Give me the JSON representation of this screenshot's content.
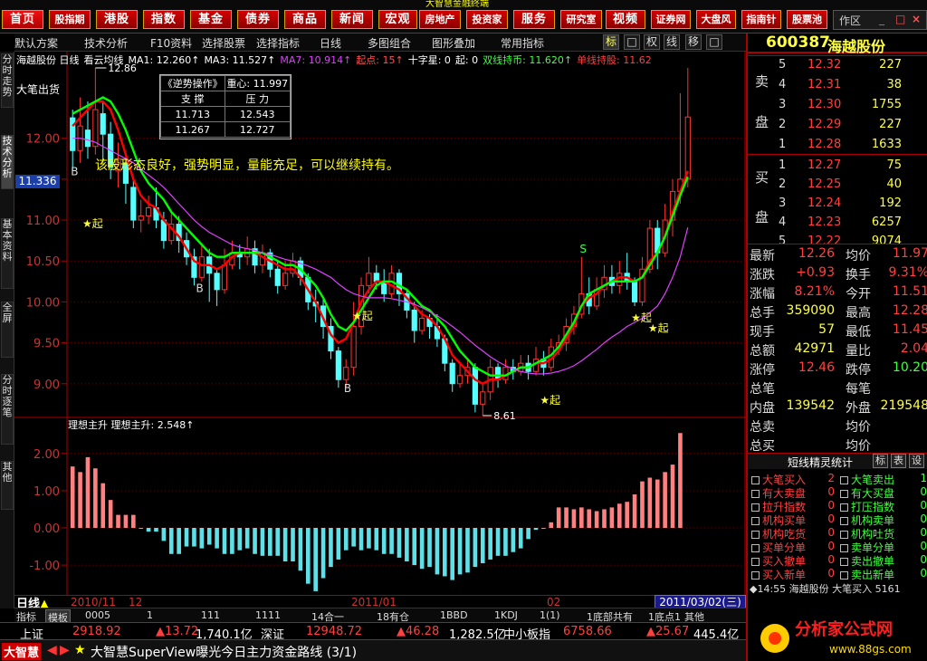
{
  "nav": {
    "items": [
      "首页",
      "股指期",
      "港股",
      "指数",
      "基金",
      "债券",
      "商品",
      "新闻",
      "宏观",
      "房地产",
      "投资家",
      "服务",
      "研究室",
      "视频",
      "证券网",
      "大盘风",
      "指南针",
      "股票池"
    ],
    "banner": "大智慧金融终端",
    "win_label": "作区",
    "win_min": "_",
    "win_restore": "□",
    "win_close": "×"
  },
  "toolbar": {
    "items": [
      "默认方案",
      "技术分析",
      "F10资料",
      "选择股票",
      "选择指标",
      "日线",
      "多图组合",
      "图形叠加",
      "常用指标"
    ],
    "buttons": [
      "标",
      "□",
      "权",
      "线",
      "移",
      "□"
    ]
  },
  "left_tabs": [
    "分时走势",
    "技术分析",
    "基本资料",
    "全屏",
    "分时逐笔",
    "其他"
  ],
  "chart": {
    "indicator_header": [
      "海越股份 日线",
      "看云均线",
      "MA1: 12.260↑",
      "MA3: 11.527↑",
      "MA7: 10.914↑",
      "起点: 15↑",
      "十字星: 0",
      "起: 0",
      "双线持币: 11.620↑",
      "单线持股: 11.62"
    ],
    "top_label": "12.86",
    "low_label": "8.61",
    "bigpen_label": "大笔出货",
    "current_price_label": "11.336",
    "comment": "该股形态良好，强势明显，量能充足，可以继续持有。",
    "sr_box": {
      "title": "《逆势操作》",
      "center": "重心: 11.997",
      "col1": "支 撑",
      "col2": "压 力",
      "rows": [
        [
          "11.713",
          "12.543"
        ],
        [
          "11.267",
          "12.727"
        ]
      ]
    },
    "markers": {
      "qi": "★起",
      "b": "B",
      "s": "S"
    },
    "osc_header": "理想主升  理想主升: 2.548↑",
    "day_line_label": "日线",
    "dates": [
      "2010/11",
      "12",
      "2011/01",
      "02"
    ],
    "date_box": "2011/03/02(三)"
  },
  "chart_data": [
    {
      "type": "candlestick",
      "title": "海越股份 日线",
      "ylim": [
        8.61,
        12.86
      ],
      "y_ticks": [
        9.0,
        9.5,
        10.0,
        10.5,
        11.0,
        11.5,
        12.0
      ],
      "candles": [
        [
          12.25,
          11.85,
          12.35,
          11.6
        ],
        [
          11.85,
          12.15,
          12.5,
          11.7
        ],
        [
          12.1,
          11.9,
          12.45,
          11.75
        ],
        [
          11.9,
          12.35,
          12.86,
          11.8
        ],
        [
          12.3,
          12.05,
          12.45,
          11.7
        ],
        [
          12.05,
          11.65,
          12.2,
          11.5
        ],
        [
          11.6,
          11.75,
          11.95,
          11.4
        ],
        [
          11.7,
          11.45,
          11.8,
          11.2
        ],
        [
          11.4,
          11.0,
          11.5,
          10.9
        ],
        [
          11.0,
          11.05,
          11.25,
          10.85
        ],
        [
          11.05,
          11.15,
          11.3,
          10.95
        ],
        [
          11.15,
          11.0,
          11.4,
          10.9
        ],
        [
          11.0,
          10.75,
          11.1,
          10.65
        ],
        [
          10.75,
          10.95,
          11.1,
          10.7
        ],
        [
          10.95,
          10.75,
          11.05,
          10.6
        ],
        [
          10.75,
          10.55,
          10.85,
          10.45
        ],
        [
          10.55,
          10.3,
          10.65,
          10.2
        ],
        [
          10.3,
          10.55,
          10.7,
          10.25
        ],
        [
          10.55,
          10.35,
          10.65,
          10.0
        ],
        [
          10.35,
          10.15,
          10.4,
          9.95
        ],
        [
          10.15,
          10.45,
          10.65,
          10.1
        ],
        [
          10.45,
          10.6,
          10.75,
          10.4
        ],
        [
          10.6,
          10.55,
          10.7,
          10.4
        ],
        [
          10.55,
          10.65,
          10.8,
          10.45
        ],
        [
          10.65,
          10.45,
          10.75,
          10.35
        ],
        [
          10.45,
          10.6,
          10.7,
          10.35
        ],
        [
          10.6,
          10.4,
          10.65,
          10.3
        ],
        [
          10.4,
          10.2,
          10.5,
          10.1
        ],
        [
          10.2,
          10.35,
          10.5,
          10.15
        ],
        [
          10.35,
          10.5,
          10.6,
          10.3
        ],
        [
          10.5,
          10.3,
          10.55,
          10.2
        ],
        [
          10.3,
          10.0,
          10.35,
          9.9
        ],
        [
          10.0,
          9.95,
          10.15,
          9.75
        ],
        [
          9.95,
          9.7,
          10.05,
          9.55
        ],
        [
          9.7,
          9.4,
          9.8,
          9.3
        ],
        [
          9.4,
          9.05,
          9.45,
          8.95
        ],
        [
          9.05,
          9.2,
          9.3,
          8.95
        ],
        [
          9.2,
          9.7,
          10.0,
          9.1
        ],
        [
          9.7,
          10.2,
          10.3,
          9.6
        ],
        [
          10.2,
          10.35,
          10.55,
          10.1
        ],
        [
          10.35,
          10.25,
          10.45,
          10.15
        ],
        [
          10.25,
          10.1,
          10.4,
          10.0
        ],
        [
          10.1,
          10.35,
          10.45,
          10.05
        ],
        [
          10.35,
          10.1,
          10.4,
          9.95
        ],
        [
          10.1,
          9.9,
          10.15,
          9.8
        ],
        [
          9.9,
          9.65,
          10.0,
          9.5
        ],
        [
          9.65,
          9.8,
          9.9,
          9.6
        ],
        [
          9.8,
          9.7,
          9.85,
          9.55
        ],
        [
          9.7,
          9.55,
          9.85,
          9.45
        ],
        [
          9.55,
          9.25,
          9.6,
          9.15
        ],
        [
          9.25,
          9.0,
          9.3,
          8.9
        ],
        [
          9.0,
          9.1,
          9.25,
          8.95
        ],
        [
          9.1,
          9.2,
          9.3,
          9.0
        ],
        [
          9.2,
          8.75,
          9.25,
          8.65
        ],
        [
          8.75,
          8.9,
          9.0,
          8.61
        ],
        [
          8.9,
          9.2,
          9.3,
          8.8
        ],
        [
          9.2,
          9.05,
          9.25,
          8.95
        ],
        [
          9.05,
          9.2,
          9.3,
          9.0
        ],
        [
          9.2,
          9.15,
          9.3,
          9.05
        ],
        [
          9.15,
          9.25,
          9.35,
          9.1
        ],
        [
          9.25,
          9.15,
          9.35,
          9.05
        ],
        [
          9.15,
          9.3,
          9.45,
          9.1
        ],
        [
          9.3,
          9.2,
          9.4,
          9.1
        ],
        [
          9.2,
          9.45,
          9.55,
          9.15
        ],
        [
          9.45,
          9.5,
          9.6,
          9.35
        ],
        [
          9.5,
          9.7,
          9.8,
          9.4
        ],
        [
          9.7,
          9.85,
          9.95,
          9.6
        ],
        [
          9.85,
          10.1,
          10.55,
          9.8
        ],
        [
          10.1,
          9.95,
          10.3,
          9.85
        ],
        [
          9.95,
          10.15,
          10.3,
          9.9
        ],
        [
          10.15,
          10.3,
          10.45,
          10.05
        ],
        [
          10.3,
          10.2,
          10.45,
          10.1
        ],
        [
          10.2,
          10.35,
          10.5,
          10.1
        ],
        [
          10.35,
          10.25,
          10.6,
          10.15
        ],
        [
          10.25,
          10.0,
          10.3,
          9.95
        ],
        [
          10.0,
          10.4,
          10.55,
          9.95
        ],
        [
          10.4,
          10.9,
          11.0,
          10.35
        ],
        [
          10.9,
          10.6,
          11.0,
          10.4
        ],
        [
          10.6,
          11.0,
          11.2,
          10.55
        ],
        [
          11.0,
          11.35,
          11.5,
          10.8
        ],
        [
          11.35,
          11.5,
          12.55,
          11.2
        ],
        [
          11.5,
          12.26,
          12.86,
          11.4
        ]
      ],
      "ma_series": [
        {
          "name": "MA1",
          "color": "#ff0000",
          "values": [
            12.15,
            12.25,
            12.35,
            12.45,
            12.45,
            12.35,
            12.1,
            11.8,
            11.5,
            11.3,
            11.2,
            11.15,
            11.0,
            10.9,
            10.8,
            10.65,
            10.5,
            10.45,
            10.45,
            10.4,
            10.45,
            10.55,
            10.6,
            10.6,
            10.6,
            10.55,
            10.5,
            10.45,
            10.4,
            10.4,
            10.3,
            10.15,
            10.0,
            9.8,
            9.6,
            9.5,
            9.55,
            9.75,
            10.0,
            10.15,
            10.25,
            10.25,
            10.2,
            10.15,
            10.05,
            9.95,
            9.85,
            9.8,
            9.7,
            9.55,
            9.35,
            9.25,
            9.15,
            9.05,
            9.0,
            9.05,
            9.05,
            9.1,
            9.15,
            9.2,
            9.2,
            9.25,
            9.25,
            9.3,
            9.4,
            9.55,
            9.7,
            9.95,
            10.05,
            10.1,
            10.2,
            10.25,
            10.3,
            10.3,
            10.25,
            10.3,
            10.5,
            10.6,
            10.8,
            11.1,
            11.35,
            11.6
          ]
        },
        {
          "name": "MA3",
          "color": "#00ff00",
          "values": [
            12.3,
            12.35,
            12.4,
            12.45,
            12.5,
            12.45,
            12.3,
            12.1,
            11.85,
            11.6,
            11.45,
            11.35,
            11.25,
            11.1,
            11.0,
            10.9,
            10.8,
            10.7,
            10.6,
            10.55,
            10.55,
            10.6,
            10.6,
            10.6,
            10.6,
            10.6,
            10.55,
            10.5,
            10.45,
            10.45,
            10.4,
            10.3,
            10.2,
            10.05,
            9.85,
            9.7,
            9.65,
            9.75,
            9.9,
            10.05,
            10.2,
            10.25,
            10.25,
            10.2,
            10.15,
            10.05,
            9.95,
            9.9,
            9.8,
            9.7,
            9.55,
            9.4,
            9.3,
            9.2,
            9.15,
            9.1,
            9.1,
            9.1,
            9.15,
            9.2,
            9.2,
            9.25,
            9.3,
            9.35,
            9.45,
            9.6,
            9.75,
            9.95,
            10.1,
            10.15,
            10.2,
            10.25,
            10.25,
            10.25,
            10.25,
            10.3,
            10.45,
            10.6,
            10.8,
            11.05,
            11.3,
            11.53
          ]
        },
        {
          "name": "MA7",
          "color": "#e040ff",
          "values": [
            12.0,
            12.0,
            11.98,
            11.95,
            11.9,
            11.85,
            11.8,
            11.75,
            11.7,
            11.62,
            11.55,
            11.48,
            11.4,
            11.3,
            11.2,
            11.1,
            11.0,
            10.92,
            10.85,
            10.8,
            10.75,
            10.7,
            10.67,
            10.65,
            10.63,
            10.6,
            10.58,
            10.55,
            10.52,
            10.5,
            10.47,
            10.44,
            10.4,
            10.35,
            10.3,
            10.22,
            10.15,
            10.1,
            10.07,
            10.05,
            10.05,
            10.05,
            10.04,
            10.02,
            10.0,
            9.97,
            9.93,
            9.88,
            9.83,
            9.77,
            9.7,
            9.63,
            9.55,
            9.47,
            9.4,
            9.33,
            9.27,
            9.22,
            9.18,
            9.15,
            9.13,
            9.12,
            9.12,
            9.13,
            9.15,
            9.18,
            9.22,
            9.28,
            9.35,
            9.42,
            9.5,
            9.57,
            9.63,
            9.7,
            9.75,
            9.8,
            9.87,
            9.95,
            10.1,
            10.3,
            10.55,
            10.91
          ]
        }
      ]
    },
    {
      "type": "bar",
      "title": "理想主升",
      "ylim": [
        -1.8,
        2.7
      ],
      "y_ticks": [
        -1.0,
        0.0,
        1.0,
        2.0
      ],
      "values": [
        1.65,
        1.5,
        1.9,
        1.6,
        1.2,
        0.75,
        0.35,
        0.35,
        0.35,
        0.0,
        -0.1,
        -0.1,
        -0.35,
        -0.7,
        -0.7,
        -0.5,
        -0.5,
        -0.55,
        -0.45,
        -0.55,
        -0.7,
        -0.7,
        -0.6,
        -0.55,
        -0.7,
        -0.75,
        -0.75,
        -0.75,
        -0.9,
        -0.9,
        -1.15,
        -1.5,
        -1.7,
        -1.35,
        -1.05,
        -0.85,
        -0.6,
        -0.5,
        -0.6,
        -0.55,
        -0.6,
        -0.7,
        -0.7,
        -0.8,
        -0.9,
        -1.0,
        -1.1,
        -1.05,
        -1.25,
        -1.3,
        -1.4,
        -1.25,
        -1.2,
        -1.05,
        -0.95,
        -0.85,
        -0.75,
        -0.75,
        -0.65,
        -0.55,
        -0.3,
        -0.05,
        0.0,
        0.15,
        0.55,
        0.55,
        0.5,
        0.55,
        0.5,
        0.45,
        0.5,
        0.55,
        0.65,
        0.7,
        0.9,
        1.25,
        1.35,
        1.3,
        1.5,
        1.7,
        2.548
      ]
    }
  ],
  "right_panel": {
    "code": "600387",
    "name": "海越股份",
    "sell_label": [
      "卖",
      "盘"
    ],
    "buy_label": [
      "买",
      "盘"
    ],
    "sell": [
      [
        "5",
        "12.32",
        "227"
      ],
      [
        "4",
        "12.31",
        "38"
      ],
      [
        "3",
        "12.30",
        "1755"
      ],
      [
        "2",
        "12.29",
        "227"
      ],
      [
        "1",
        "12.28",
        "1633"
      ]
    ],
    "buy": [
      [
        "1",
        "12.27",
        "75"
      ],
      [
        "2",
        "12.25",
        "40"
      ],
      [
        "3",
        "12.24",
        "192"
      ],
      [
        "4",
        "12.23",
        "6257"
      ],
      [
        "5",
        "12.22",
        "9074"
      ]
    ],
    "quote": [
      [
        "最新",
        "12.26",
        "均价",
        "11.97"
      ],
      [
        "涨跌",
        "+0.93",
        "换手",
        "9.31%"
      ],
      [
        "涨幅",
        "8.21%",
        "今开",
        "11.51"
      ],
      [
        "总手",
        "359090",
        "最高",
        "12.28"
      ],
      [
        "现手",
        "57",
        "最低",
        "11.45"
      ],
      [
        "总额",
        "42971",
        "量比",
        "2.04"
      ],
      [
        "涨停",
        "12.46",
        "跌停",
        "10.20"
      ],
      [
        "总笔",
        "",
        "每笔",
        ""
      ],
      [
        "内盘",
        "139542",
        "外盘",
        "219548"
      ],
      [
        "总卖",
        "",
        "均价",
        ""
      ],
      [
        "总买",
        "",
        "均价",
        ""
      ]
    ],
    "sj_title": "短线精灵统计",
    "sj_buttons": [
      "标",
      "表",
      "设"
    ],
    "sj_items": [
      [
        "大笔买入",
        "2",
        "大笔卖出",
        "1"
      ],
      [
        "有大卖盘",
        "0",
        "有大买盘",
        "0"
      ],
      [
        "拉升指数",
        "0",
        "打压指数",
        "0"
      ],
      [
        "机构买单",
        "0",
        "机构卖单",
        "0"
      ],
      [
        "机构吃货",
        "0",
        "机构吐货",
        "0"
      ],
      [
        "买单分单",
        "0",
        "卖单分单",
        "0"
      ],
      [
        "买入撤单",
        "0",
        "卖出撤单",
        "0"
      ],
      [
        "买入新单",
        "0",
        "卖出新单",
        "0"
      ]
    ],
    "sj_event": "◆14:55  海越股份  大笔买入  5161",
    "logo_text": "分析家公式网",
    "logo_url": "www.88gs.com"
  },
  "bottom_tabs": [
    "指标",
    "模板",
    "0005",
    "1",
    "111",
    "1111",
    "14合一",
    "18有仓",
    "1BBD",
    "1KDJ",
    "1(1)",
    "1底部共有",
    "1底点1",
    "其他"
  ],
  "index_bar": [
    [
      "上证",
      "2918.92",
      "▲13.72",
      "1,740.1亿"
    ],
    [
      "深证",
      "12948.72",
      "▲46.28",
      "1,282.5亿"
    ],
    [
      "中小板指",
      "6758.66",
      "▲25.67",
      "445.4亿"
    ]
  ],
  "ticker": {
    "brand": "大智慧",
    "text": "大智慧SuperView曝光今日主力资金路线 (3/1)"
  }
}
